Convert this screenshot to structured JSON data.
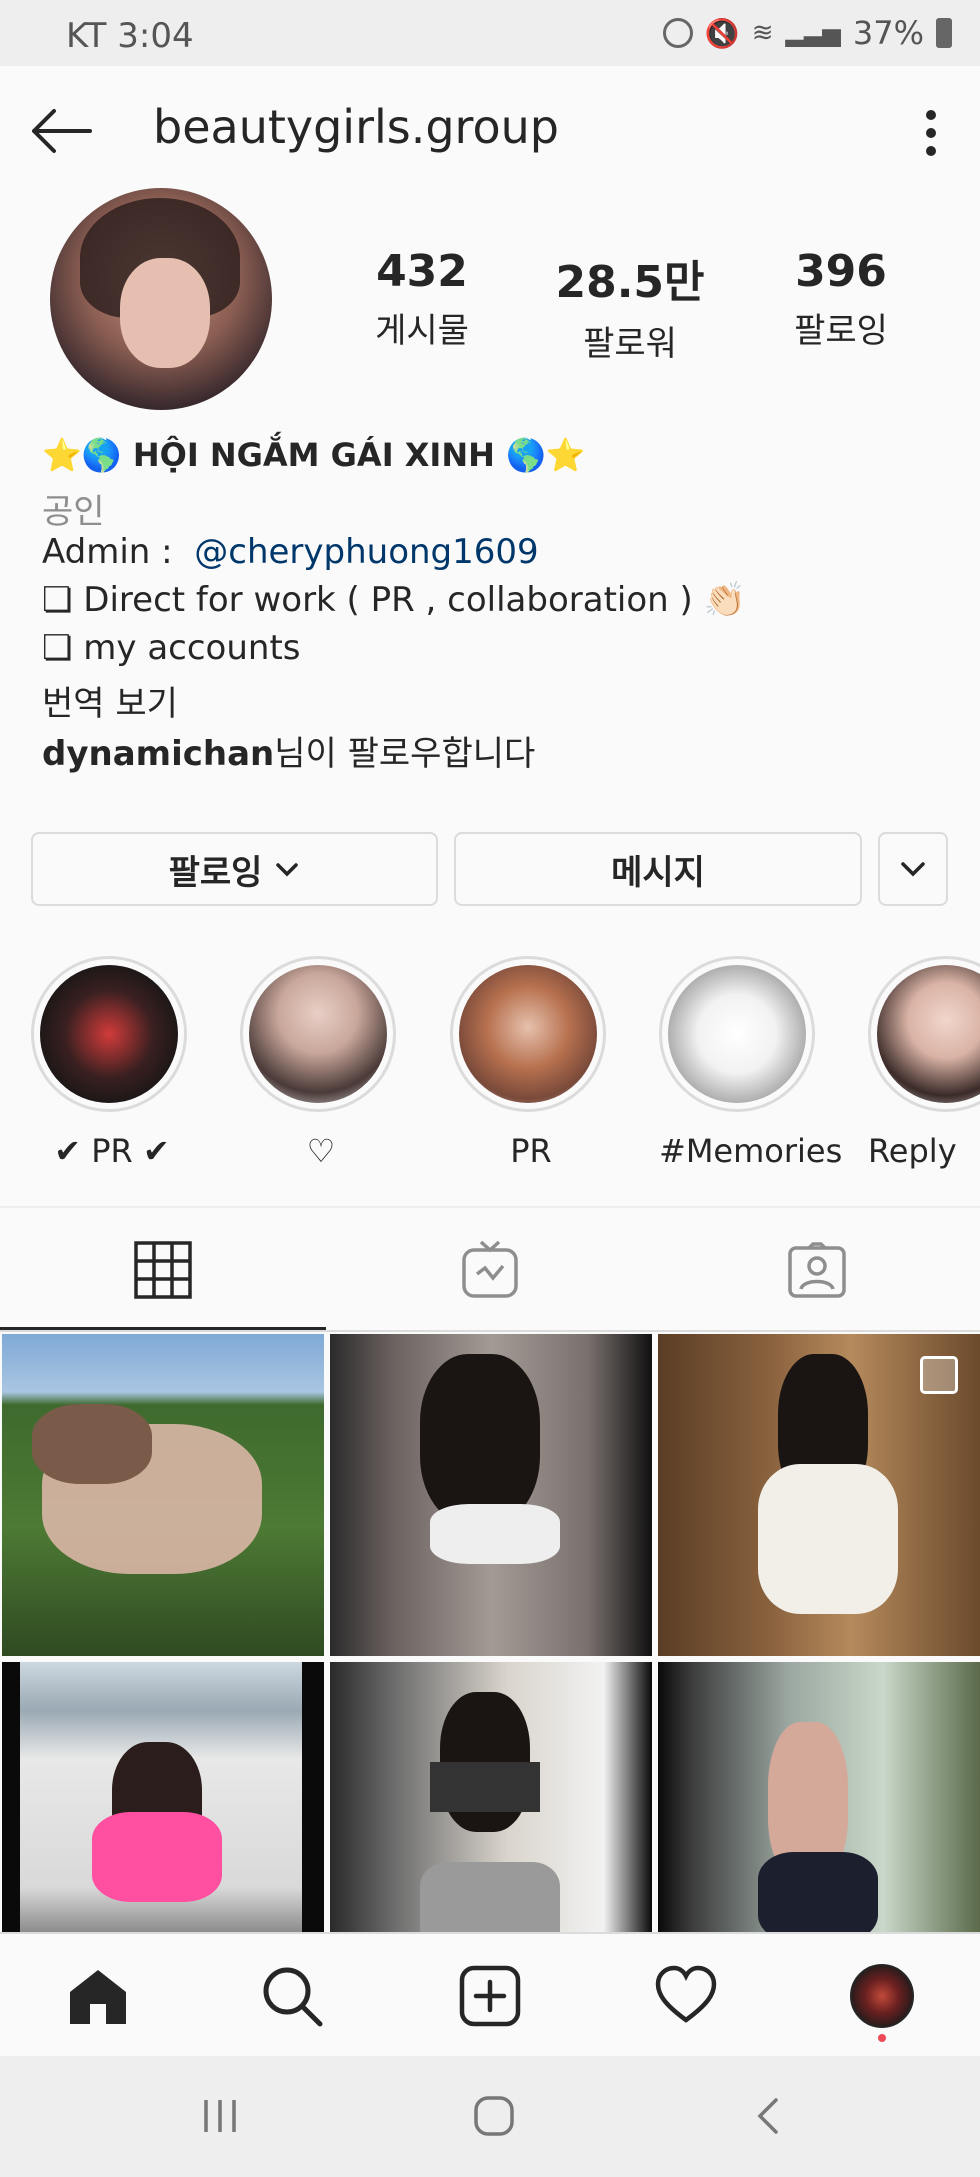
{
  "status_bar": {
    "carrier": "KT",
    "time": "3:04",
    "battery": "37%"
  },
  "header": {
    "username": "beautygirls.group"
  },
  "stats": [
    {
      "value": "432",
      "label": "게시물"
    },
    {
      "value": "28.5만",
      "label": "팔로워"
    },
    {
      "value": "396",
      "label": "팔로잉"
    }
  ],
  "bio": {
    "name": "⭐🌎 HỘI NGẮM GÁI XINH 🌎⭐",
    "category": "공인",
    "admin_prefix": "Admin :  ",
    "admin_handle": "@cheryphuong1609",
    "line2": "❏ Direct for work  ( PR , collaboration ) 👏🏻",
    "line3": "❏ my accounts",
    "translate": "번역 보기",
    "followed_by_user": "dynamichan",
    "followed_by_suffix": "님이 팔로우합니다"
  },
  "buttons": {
    "following": "팔로잉",
    "message": "메시지"
  },
  "highlights": [
    {
      "label": "✔ PR ✔"
    },
    {
      "label": "♡"
    },
    {
      "label": "PR"
    },
    {
      "label": "#Memories"
    },
    {
      "label": "Reply"
    }
  ],
  "tabs": [
    "grid-icon",
    "igtv-icon",
    "tagged-icon"
  ],
  "colors": {
    "link": "#00376b",
    "text": "#262626",
    "secondary": "#8e8e8e",
    "border": "#dbdbdb",
    "notification": "#ed4956"
  }
}
